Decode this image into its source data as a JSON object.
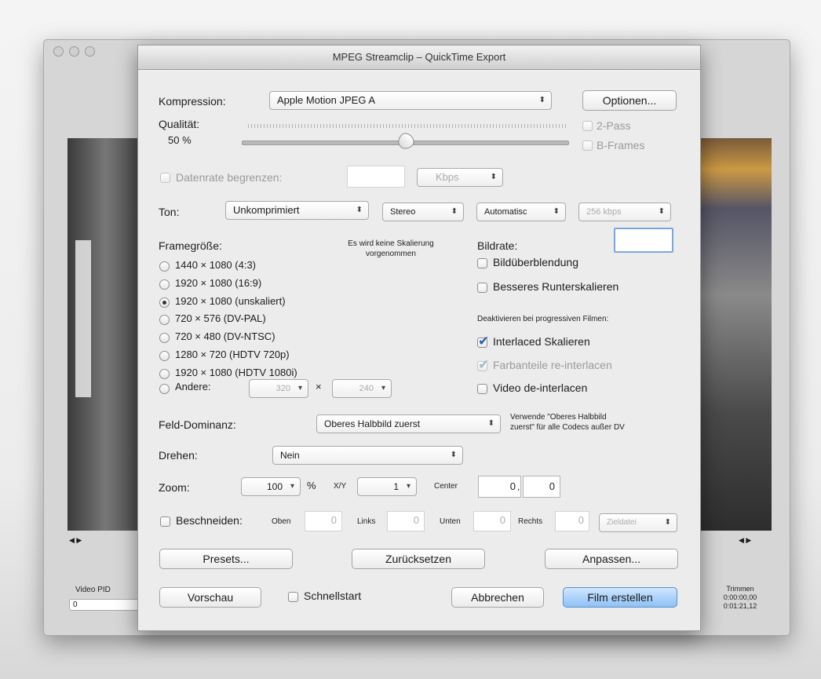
{
  "background_window": {
    "video_pid_label": "Video PID",
    "video_pid_value": "0",
    "trim_label": "Trimmen",
    "trim_start": "0:00:00,00",
    "trim_end": "0:01:21,12"
  },
  "dialog": {
    "title": "MPEG Streamclip – QuickTime Export",
    "compression": {
      "label": "Kompression:",
      "value": "Apple Motion JPEG A",
      "options_button": "Optionen..."
    },
    "quality": {
      "label": "Qualität:",
      "value": "50 %",
      "fraction": 0.5
    },
    "two_pass": "2-Pass",
    "b_frames": "B-Frames",
    "datarate": {
      "label": "Datenrate begrenzen:",
      "value": "",
      "unit": "Kbps"
    },
    "sound": {
      "label": "Ton:",
      "codec": "Unkomprimiert",
      "channels": "Stereo",
      "rate": "Automatisc",
      "bitrate": "256 kbps"
    },
    "framesize": {
      "label": "Framegröße:",
      "note": "Es wird keine Skalierung vorgenommen",
      "options": [
        {
          "text": "1440 × 1080  (4:3)",
          "selected": false
        },
        {
          "text": "1920 × 1080  (16:9)",
          "selected": false
        },
        {
          "text": "1920 × 1080  (unskaliert)",
          "selected": true
        },
        {
          "text": "720 × 576  (DV-PAL)",
          "selected": false
        },
        {
          "text": "720 × 480  (DV-NTSC)",
          "selected": false
        },
        {
          "text": "1280 × 720  (HDTV 720p)",
          "selected": false
        },
        {
          "text": "1920 × 1080  (HDTV 1080i)",
          "selected": false
        }
      ],
      "other_label": "Andere:",
      "other_width": "320",
      "other_x": "×",
      "other_height": "240"
    },
    "framerate": {
      "label": "Bildrate:",
      "value": ""
    },
    "frame_blending": "Bildüberblendung",
    "better_downscaling": "Besseres Runterskalieren",
    "progressive_note": "Deaktivieren bei progressiven Filmen:",
    "interlaced_scaling": "Interlaced Skalieren",
    "chroma_reinterlace": "Farbanteile re-interlacen",
    "deinterlace": "Video de-interlacen",
    "field_dominance": {
      "label": "Feld-Dominanz:",
      "value": "Oberes Halbbild zuerst",
      "note_line1": "Verwende \"Oberes Halbbild",
      "note_line2": "zuerst\" für alle Codecs außer DV"
    },
    "rotate": {
      "label": "Drehen:",
      "value": "Nein"
    },
    "zoom": {
      "label": "Zoom:",
      "value": "100",
      "percent": "%",
      "xy_label": "X/Y",
      "xy_value": "1",
      "center_label": "Center",
      "center_x": "0",
      "center_sep": ",",
      "center_y": "0"
    },
    "crop": {
      "label": "Beschneiden:",
      "top_label": "Oben",
      "top": "0",
      "left_label": "Links",
      "left": "0",
      "bottom_label": "Unten",
      "bottom": "0",
      "right_label": "Rechts",
      "right": "0",
      "target": "Zieldatei"
    },
    "buttons": {
      "presets": "Presets...",
      "reset": "Zurücksetzen",
      "adjust": "Anpassen...",
      "preview": "Vorschau",
      "quickstart": "Schnellstart",
      "cancel": "Abbrechen",
      "create": "Film erstellen"
    }
  }
}
